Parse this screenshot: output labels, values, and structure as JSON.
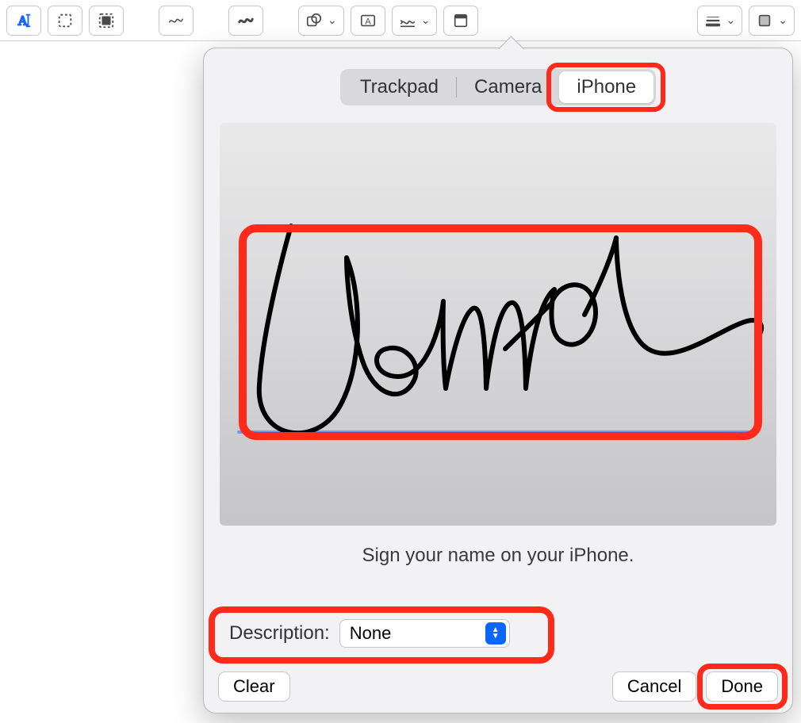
{
  "toolbar": {
    "text_tool": "text-icon",
    "select_rect": "select-rect-icon",
    "select_full": "select-full-icon",
    "draw1": "scribble-thin-icon",
    "draw2": "scribble-bold-icon",
    "shapes": "shapes-icon",
    "textbox": "text-box-icon",
    "signature": "signature-icon",
    "crop": "crop-icon",
    "stroke": "line-weight-icon",
    "fill": "fill-color-icon"
  },
  "popover": {
    "tabs": {
      "trackpad": "Trackpad",
      "camera": "Camera",
      "iphone": "iPhone",
      "selected": "iPhone"
    },
    "instruction": "Sign your name on your iPhone.",
    "description_label": "Description:",
    "description_value": "None",
    "clear": "Clear",
    "cancel": "Cancel",
    "done": "Done"
  },
  "highlights": {
    "segment": true,
    "canvas": true,
    "description": true,
    "done": true
  }
}
